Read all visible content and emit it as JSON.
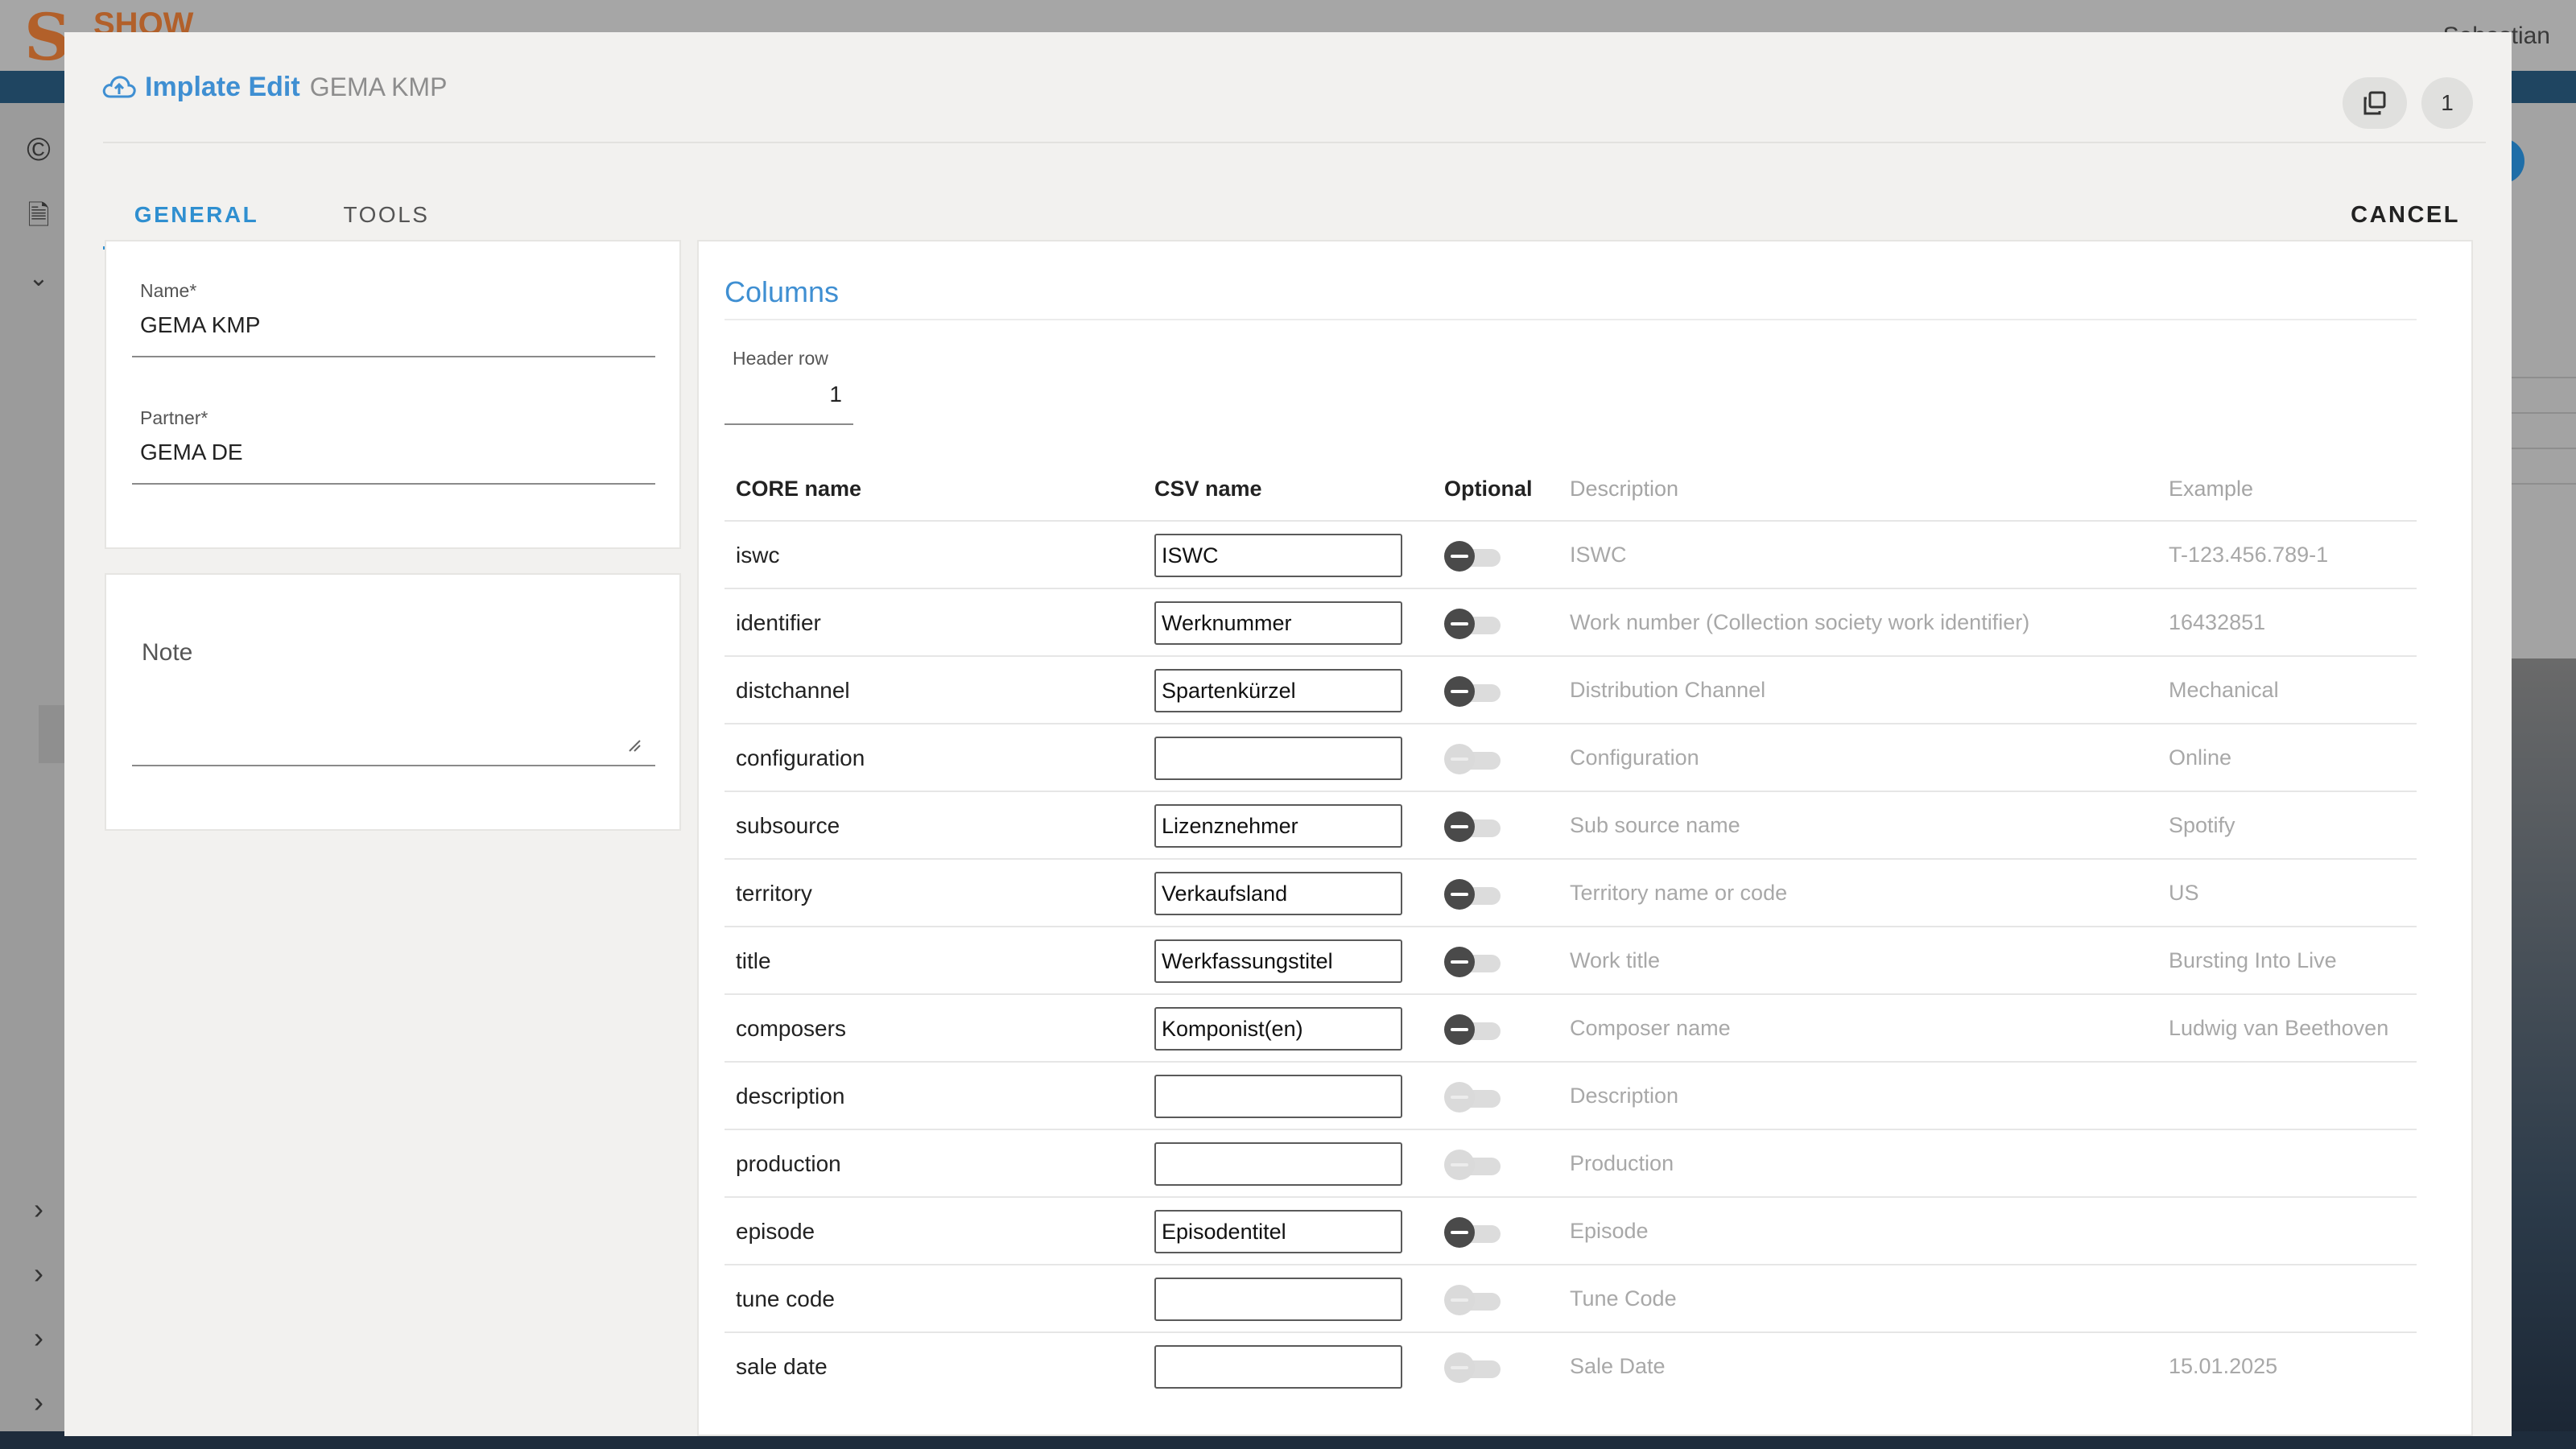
{
  "background": {
    "logo_text": "SHOW",
    "user_name": "Sebastian"
  },
  "dialog": {
    "title": "Implate Edit",
    "subtitle": "GEMA KMP",
    "header_badge": "1",
    "tabs": [
      {
        "label": "GENERAL",
        "active": true
      },
      {
        "label": "TOOLS",
        "active": false
      }
    ],
    "cancel_label": "CANCEL"
  },
  "general": {
    "name_label": "Name*",
    "name_value": "GEMA KMP",
    "partner_label": "Partner*",
    "partner_value": "GEMA DE",
    "note_label": "Note"
  },
  "columns": {
    "title": "Columns",
    "header_row_label": "Header row",
    "header_row_value": "1",
    "headers": {
      "core": "CORE name",
      "csv": "CSV name",
      "optional": "Optional",
      "description": "Description",
      "example": "Example"
    },
    "rows": [
      {
        "core": "iswc",
        "csv": "ISWC",
        "optional": true,
        "description": "ISWC",
        "example": "T-123.456.789-1"
      },
      {
        "core": "identifier",
        "csv": "Werknummer",
        "optional": true,
        "description": "Work number (Collection society work identifier)",
        "example": "16432851"
      },
      {
        "core": "distchannel",
        "csv": "Spartenkürzel",
        "optional": true,
        "description": "Distribution Channel",
        "example": "Mechanical"
      },
      {
        "core": "configuration",
        "csv": "",
        "optional": false,
        "description": "Configuration",
        "example": "Online"
      },
      {
        "core": "subsource",
        "csv": "Lizenznehmer",
        "optional": true,
        "description": "Sub source name",
        "example": "Spotify"
      },
      {
        "core": "territory",
        "csv": "Verkaufsland",
        "optional": true,
        "description": "Territory name or code",
        "example": "US"
      },
      {
        "core": "title",
        "csv": "Werkfassungstitel",
        "optional": true,
        "description": "Work title",
        "example": "Bursting Into Live"
      },
      {
        "core": "composers",
        "csv": "Komponist(en)",
        "optional": true,
        "description": "Composer name",
        "example": "Ludwig van Beethoven"
      },
      {
        "core": "description",
        "csv": "",
        "optional": false,
        "description": "Description",
        "example": ""
      },
      {
        "core": "production",
        "csv": "",
        "optional": false,
        "description": "Production",
        "example": ""
      },
      {
        "core": "episode",
        "csv": "Episodentitel",
        "optional": true,
        "description": "Episode",
        "example": ""
      },
      {
        "core": "tune code",
        "csv": "",
        "optional": false,
        "description": "Tune Code",
        "example": ""
      },
      {
        "core": "sale date",
        "csv": "",
        "optional": false,
        "description": "Sale Date",
        "example": "15.01.2025"
      }
    ]
  }
}
